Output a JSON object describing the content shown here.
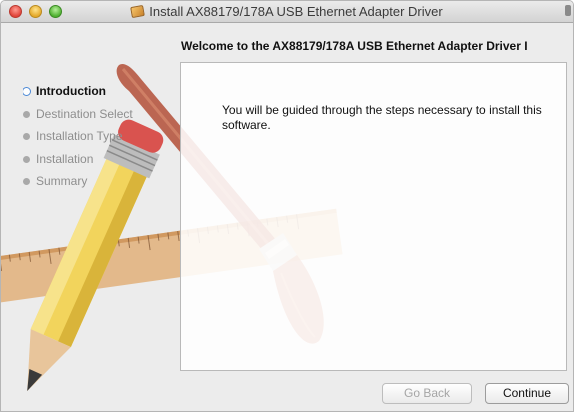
{
  "window": {
    "title": "Install AX88179/178A USB Ethernet Adapter Driver",
    "icon": "package-icon"
  },
  "heading": "Welcome to the AX88179/178A USB Ethernet Adapter Driver I",
  "steps": [
    {
      "label": "Introduction",
      "active": true
    },
    {
      "label": "Destination Select",
      "active": false
    },
    {
      "label": "Installation Type",
      "active": false
    },
    {
      "label": "Installation",
      "active": false
    },
    {
      "label": "Summary",
      "active": false
    }
  ],
  "content": {
    "message": "You will be guided through the steps necessary to install this software."
  },
  "buttons": {
    "back": "Go Back",
    "continue": "Continue"
  },
  "colors": {
    "active_step_ring": "#4a88d6",
    "pencil_yellow": "#f2d45c",
    "brush_handle": "#b0452c",
    "ruler": "#d9a56a"
  }
}
